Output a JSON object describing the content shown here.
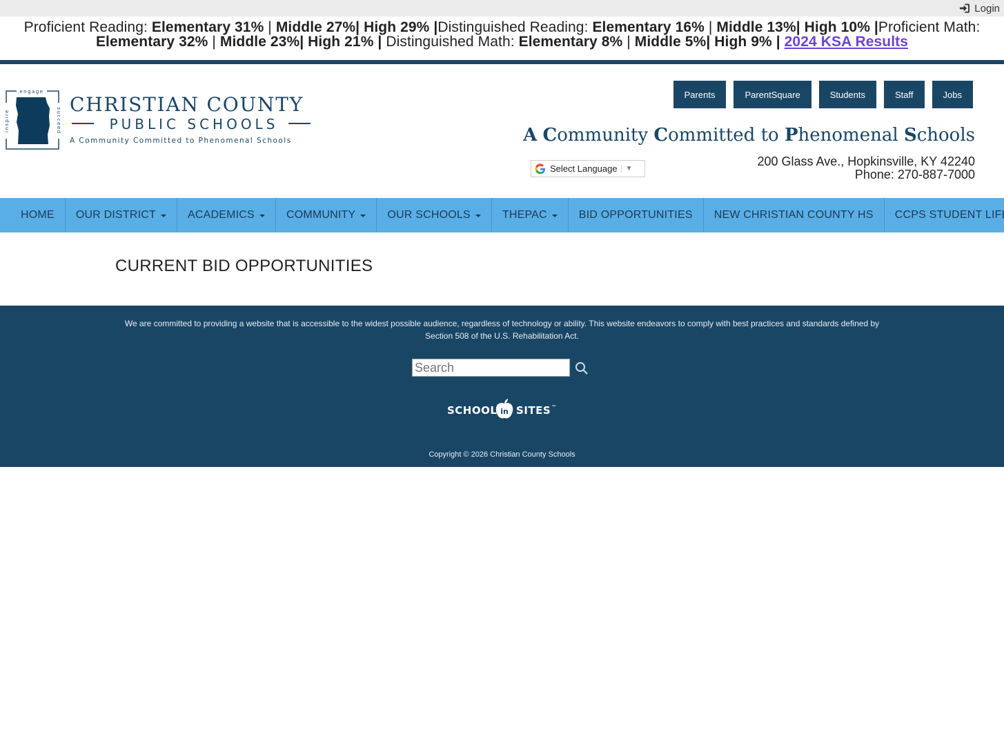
{
  "topbar": {
    "login_label": "Login"
  },
  "ticker": {
    "r1": "Proficient Reading: ",
    "r2": "Elementary 31%",
    "r3": " | ",
    "r4": "Middle 27%| High 29% |",
    "r5": "Distinguished Reading: ",
    "r6": "Elementary 16%",
    "r7": " | ",
    "r8": "Middle 13%| High 10% |",
    "r9": "Proficient Math: ",
    "r10": "Elementary 32%",
    "r11": " | ",
    "r12": "Middle 23%| High 21% |",
    "r13": " Distinguished Math: ",
    "r14": "Elementary 8%",
    "r15": " | ",
    "r16": "Middle 5%| High 9% |",
    "link": "2024 KSA Results"
  },
  "logo": {
    "line1": "CHRISTIAN COUNTY",
    "line2": "PUBLIC SCHOOLS",
    "line3": "A Community Committed to Phenomenal Schools",
    "side_top": "engage",
    "side_left": "inspire",
    "side_right": "succeed"
  },
  "top_buttons": [
    "Parents",
    "ParentSquare",
    "Students",
    "Staff",
    "Jobs"
  ],
  "tagline": {
    "c1": "A",
    "w1": " ",
    "c2": "C",
    "w2": "ommunity ",
    "c3": "C",
    "w3": "ommitted to ",
    "c4": "P",
    "w4": "henomenal ",
    "c5": "S",
    "w5": "chools"
  },
  "language": {
    "label": "Select Language",
    "arrow": "▼"
  },
  "address": {
    "street": "200 Glass Ave., Hopkinsville, KY 42240",
    "phone": "Phone: 270-887-7000"
  },
  "nav": [
    {
      "label": "HOME",
      "dropdown": false
    },
    {
      "label": "OUR DISTRICT",
      "dropdown": true
    },
    {
      "label": "ACADEMICS",
      "dropdown": true
    },
    {
      "label": "COMMUNITY",
      "dropdown": true
    },
    {
      "label": "OUR SCHOOLS",
      "dropdown": true
    },
    {
      "label": "THEPAC",
      "dropdown": true
    },
    {
      "label": "BID OPPORTUNITIES",
      "dropdown": false
    },
    {
      "label": "NEW CHRISTIAN COUNTY HS",
      "dropdown": false
    },
    {
      "label": "CCPS STUDENT LIFE",
      "dropdown": false
    }
  ],
  "main": {
    "title": "CURRENT BID OPPORTUNITIES"
  },
  "footer": {
    "accessibility": "We are committed to providing a website that is accessible to the widest possible audience, regardless of technology or ability. This website endeavors to comply with best practices and standards defined by Section 508 of the U.S. Rehabilitation Act.",
    "search_placeholder": "Search",
    "brand_left": "SCHOOL",
    "brand_mid": "in",
    "brand_right": "SITES",
    "brand_tm": "™",
    "copyright": "Copyright © 2026 Christian County Schools"
  },
  "colors": {
    "navy": "#1a4666",
    "nav_blue": "#5aaee6",
    "link_purple": "#6b43d6",
    "topbar": "#ebebeb"
  },
  "icons": [
    "sign-in-icon",
    "google-g-icon",
    "search-icon",
    "kentucky-county-icon",
    "apple-icon"
  ]
}
